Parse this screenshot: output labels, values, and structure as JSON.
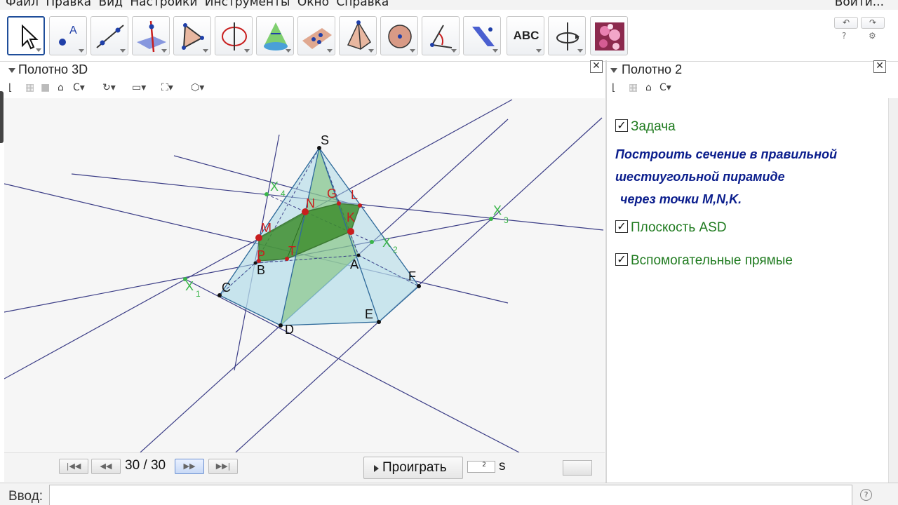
{
  "menu": {
    "items": [
      "Файл",
      "Правка",
      "Вид",
      "Настройки",
      "Инструменты",
      "Окно",
      "Справка"
    ],
    "signin": "Войти..."
  },
  "toolbar": {
    "tools": [
      {
        "name": "move-tool",
        "icon": "arrow-pointer-icon"
      },
      {
        "name": "point-tool",
        "icon": "point-icon",
        "label": "A"
      },
      {
        "name": "line-tool",
        "icon": "line-icon"
      },
      {
        "name": "perpendicular-line-tool",
        "icon": "perpendicular-line-icon"
      },
      {
        "name": "polygon-tool",
        "icon": "polygon-icon"
      },
      {
        "name": "circle-axis-tool",
        "icon": "circle-axis-icon"
      },
      {
        "name": "intersect-surfaces-tool",
        "icon": "cone-icon"
      },
      {
        "name": "plane-tool",
        "icon": "plane-points-icon"
      },
      {
        "name": "pyramid-tool",
        "icon": "pyramid-icon"
      },
      {
        "name": "sphere-tool",
        "icon": "sphere-icon"
      },
      {
        "name": "angle-tool",
        "icon": "angle-icon"
      },
      {
        "name": "reflect-tool",
        "icon": "reflect-plane-icon"
      },
      {
        "name": "text-tool",
        "icon": "text-icon",
        "label": "ABC"
      },
      {
        "name": "rotate-view-tool",
        "icon": "rotate-view-icon"
      },
      {
        "name": "image-tool",
        "icon": "flower-image-icon"
      }
    ]
  },
  "view3d": {
    "title": "Полотно 3D",
    "points": {
      "S": "S",
      "X4": "X",
      "X4sub": "4",
      "N": "N",
      "G": "G",
      "L": "L",
      "K": "K",
      "M": "M",
      "P": "P",
      "T": "T",
      "B": "B",
      "A": "A",
      "X2": "X",
      "X2sub": "2",
      "X3": "X",
      "X3sub": "3",
      "C": "C",
      "F": "F",
      "X1": "X",
      "X1sub": "1",
      "E": "E",
      "D": "D"
    },
    "colors": {
      "section": "#3f8f2f",
      "pyramid": "#a8d8e6",
      "lines": "#3b3d86",
      "points_red": "#c81e1e",
      "points_green": "#3ab54a"
    }
  },
  "animation": {
    "frame": "30 / 30",
    "play_label": "Проиграть",
    "speed_value": "2",
    "speed_unit": "s"
  },
  "view2": {
    "title": "Полотно 2",
    "checkbox_task": "Задача",
    "task_line1": "Построить сечение в правильной",
    "task_line2": "шестиугольной пирамиде",
    "task_line3": "через точки M,N,K.",
    "checkbox_plane": "Плоскость ASD",
    "checkbox_aux": "Вспомогательные прямые",
    "check_mark": "✓"
  },
  "inputbar": {
    "label": "Ввод:",
    "value": ""
  }
}
